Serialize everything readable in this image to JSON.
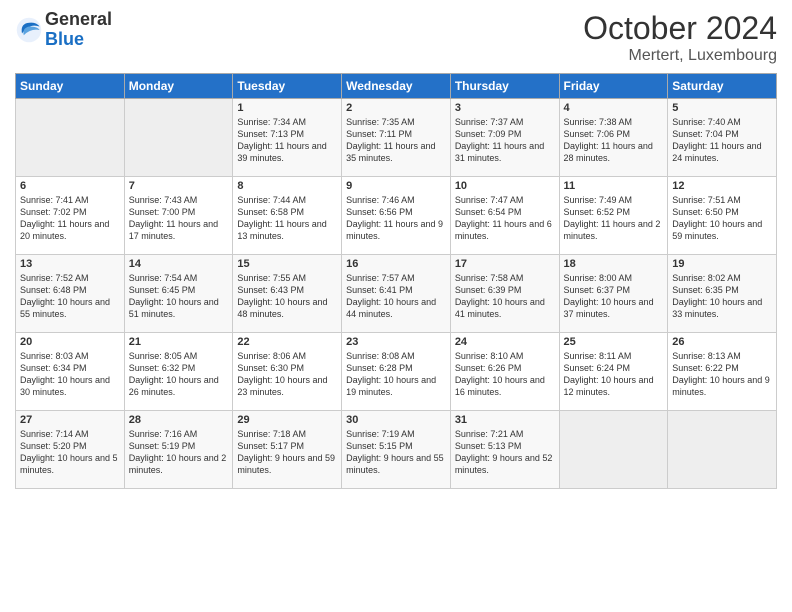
{
  "header": {
    "logo_general": "General",
    "logo_blue": "Blue",
    "title": "October 2024",
    "subtitle": "Mertert, Luxembourg"
  },
  "days_of_week": [
    "Sunday",
    "Monday",
    "Tuesday",
    "Wednesday",
    "Thursday",
    "Friday",
    "Saturday"
  ],
  "weeks": [
    [
      {
        "day": "",
        "empty": true
      },
      {
        "day": "",
        "empty": true
      },
      {
        "day": "1",
        "sunrise": "7:34 AM",
        "sunset": "7:13 PM",
        "daylight": "11 hours and 39 minutes."
      },
      {
        "day": "2",
        "sunrise": "7:35 AM",
        "sunset": "7:11 PM",
        "daylight": "11 hours and 35 minutes."
      },
      {
        "day": "3",
        "sunrise": "7:37 AM",
        "sunset": "7:09 PM",
        "daylight": "11 hours and 31 minutes."
      },
      {
        "day": "4",
        "sunrise": "7:38 AM",
        "sunset": "7:06 PM",
        "daylight": "11 hours and 28 minutes."
      },
      {
        "day": "5",
        "sunrise": "7:40 AM",
        "sunset": "7:04 PM",
        "daylight": "11 hours and 24 minutes."
      }
    ],
    [
      {
        "day": "6",
        "sunrise": "7:41 AM",
        "sunset": "7:02 PM",
        "daylight": "11 hours and 20 minutes."
      },
      {
        "day": "7",
        "sunrise": "7:43 AM",
        "sunset": "7:00 PM",
        "daylight": "11 hours and 17 minutes."
      },
      {
        "day": "8",
        "sunrise": "7:44 AM",
        "sunset": "6:58 PM",
        "daylight": "11 hours and 13 minutes."
      },
      {
        "day": "9",
        "sunrise": "7:46 AM",
        "sunset": "6:56 PM",
        "daylight": "11 hours and 9 minutes."
      },
      {
        "day": "10",
        "sunrise": "7:47 AM",
        "sunset": "6:54 PM",
        "daylight": "11 hours and 6 minutes."
      },
      {
        "day": "11",
        "sunrise": "7:49 AM",
        "sunset": "6:52 PM",
        "daylight": "11 hours and 2 minutes."
      },
      {
        "day": "12",
        "sunrise": "7:51 AM",
        "sunset": "6:50 PM",
        "daylight": "10 hours and 59 minutes."
      }
    ],
    [
      {
        "day": "13",
        "sunrise": "7:52 AM",
        "sunset": "6:48 PM",
        "daylight": "10 hours and 55 minutes."
      },
      {
        "day": "14",
        "sunrise": "7:54 AM",
        "sunset": "6:45 PM",
        "daylight": "10 hours and 51 minutes."
      },
      {
        "day": "15",
        "sunrise": "7:55 AM",
        "sunset": "6:43 PM",
        "daylight": "10 hours and 48 minutes."
      },
      {
        "day": "16",
        "sunrise": "7:57 AM",
        "sunset": "6:41 PM",
        "daylight": "10 hours and 44 minutes."
      },
      {
        "day": "17",
        "sunrise": "7:58 AM",
        "sunset": "6:39 PM",
        "daylight": "10 hours and 41 minutes."
      },
      {
        "day": "18",
        "sunrise": "8:00 AM",
        "sunset": "6:37 PM",
        "daylight": "10 hours and 37 minutes."
      },
      {
        "day": "19",
        "sunrise": "8:02 AM",
        "sunset": "6:35 PM",
        "daylight": "10 hours and 33 minutes."
      }
    ],
    [
      {
        "day": "20",
        "sunrise": "8:03 AM",
        "sunset": "6:34 PM",
        "daylight": "10 hours and 30 minutes."
      },
      {
        "day": "21",
        "sunrise": "8:05 AM",
        "sunset": "6:32 PM",
        "daylight": "10 hours and 26 minutes."
      },
      {
        "day": "22",
        "sunrise": "8:06 AM",
        "sunset": "6:30 PM",
        "daylight": "10 hours and 23 minutes."
      },
      {
        "day": "23",
        "sunrise": "8:08 AM",
        "sunset": "6:28 PM",
        "daylight": "10 hours and 19 minutes."
      },
      {
        "day": "24",
        "sunrise": "8:10 AM",
        "sunset": "6:26 PM",
        "daylight": "10 hours and 16 minutes."
      },
      {
        "day": "25",
        "sunrise": "8:11 AM",
        "sunset": "6:24 PM",
        "daylight": "10 hours and 12 minutes."
      },
      {
        "day": "26",
        "sunrise": "8:13 AM",
        "sunset": "6:22 PM",
        "daylight": "10 hours and 9 minutes."
      }
    ],
    [
      {
        "day": "27",
        "sunrise": "7:14 AM",
        "sunset": "5:20 PM",
        "daylight": "10 hours and 5 minutes."
      },
      {
        "day": "28",
        "sunrise": "7:16 AM",
        "sunset": "5:19 PM",
        "daylight": "10 hours and 2 minutes."
      },
      {
        "day": "29",
        "sunrise": "7:18 AM",
        "sunset": "5:17 PM",
        "daylight": "9 hours and 59 minutes."
      },
      {
        "day": "30",
        "sunrise": "7:19 AM",
        "sunset": "5:15 PM",
        "daylight": "9 hours and 55 minutes."
      },
      {
        "day": "31",
        "sunrise": "7:21 AM",
        "sunset": "5:13 PM",
        "daylight": "9 hours and 52 minutes."
      },
      {
        "day": "",
        "empty": true
      },
      {
        "day": "",
        "empty": true
      }
    ]
  ]
}
